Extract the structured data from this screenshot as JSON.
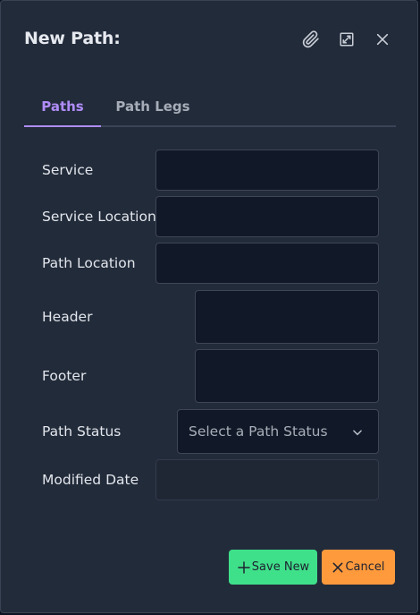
{
  "dialog": {
    "title": "New Path:",
    "icons": {
      "attach": "paperclip-icon",
      "expand": "expand-icon",
      "close": "close-icon"
    }
  },
  "tabs": [
    {
      "label": "Paths",
      "active": true
    },
    {
      "label": "Path Legs",
      "active": false
    }
  ],
  "form": {
    "service": {
      "label": "Service",
      "value": ""
    },
    "service_location": {
      "label": "Service Location",
      "value": ""
    },
    "path_location": {
      "label": "Path Location",
      "value": ""
    },
    "header": {
      "label": "Header",
      "value": ""
    },
    "footer": {
      "label": "Footer",
      "value": ""
    },
    "path_status": {
      "label": "Path Status",
      "placeholder": "Select a Path Status"
    },
    "modified_date": {
      "label": "Modified Date",
      "value": ""
    }
  },
  "actions": {
    "save_label": "Save New",
    "cancel_label": "Cancel"
  },
  "colors": {
    "dialog_bg": "#222b3a",
    "input_bg": "#111827",
    "accent_tab": "#b08cf8",
    "save_button": "#3fe08a",
    "cancel_button": "#ff9a3c"
  }
}
